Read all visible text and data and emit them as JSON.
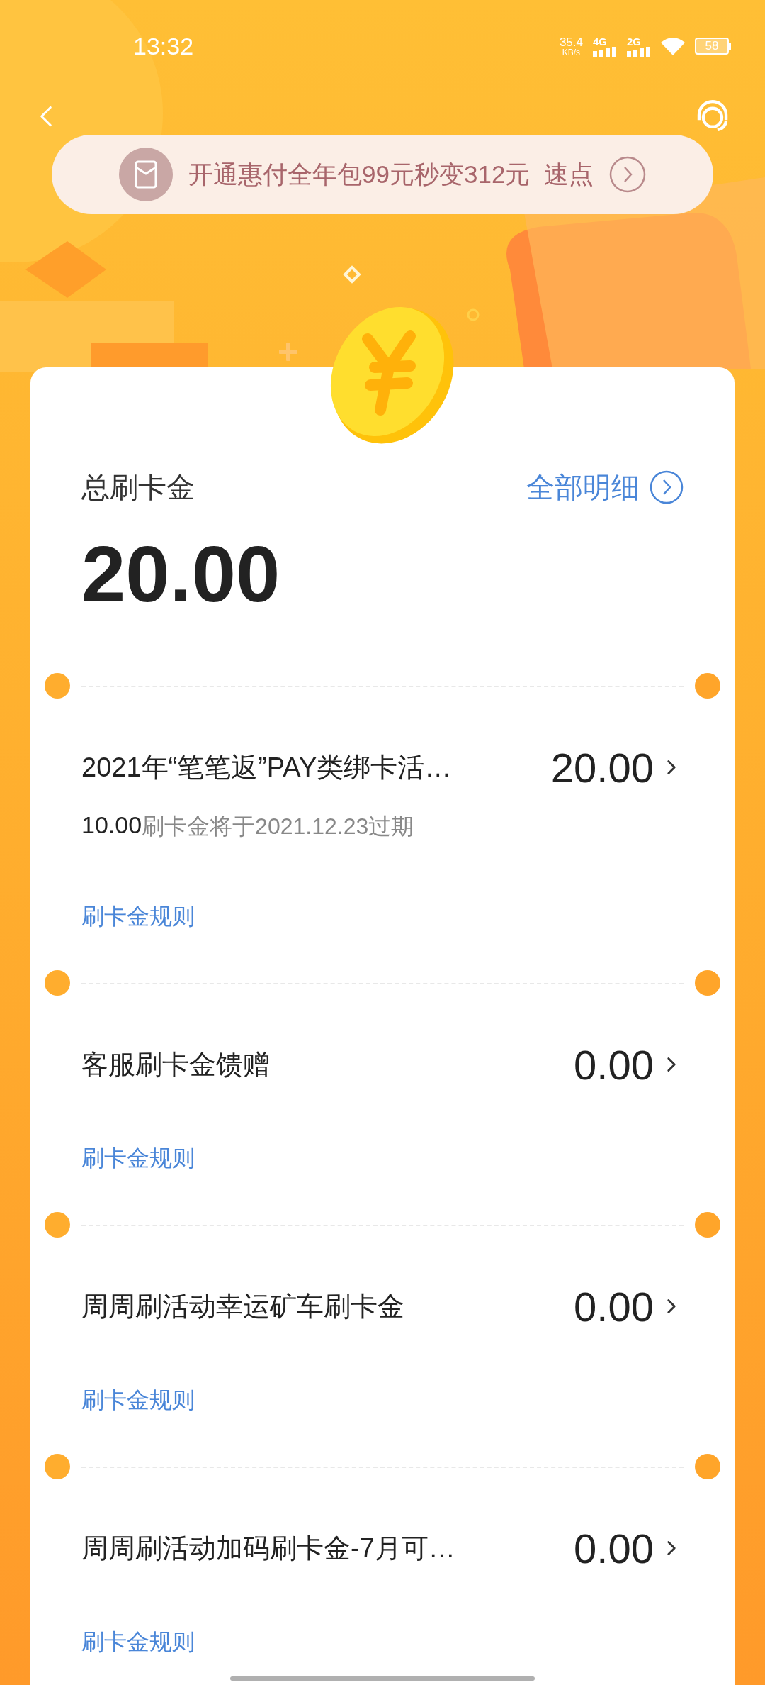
{
  "status_bar": {
    "time": "13:32",
    "net_speed": "35.4",
    "net_unit": "KB/s",
    "sim1": "4G",
    "sim2": "2G",
    "battery": "58"
  },
  "banner": {
    "text": "开通惠付全年包99元秒变312元  速点"
  },
  "summary": {
    "label": "总刷卡金",
    "detail_link": "全部明细",
    "amount": "20.00"
  },
  "items": [
    {
      "title": "2021年“笔笔返”PAY类绑卡活…",
      "amount": "20.00",
      "expiry_amount": "10.00",
      "expiry_text": "刷卡金将于2021.12.23过期",
      "rule_link": "刷卡金规则"
    },
    {
      "title": "客服刷卡金馈赠",
      "amount": "0.00",
      "rule_link": "刷卡金规则"
    },
    {
      "title": "周周刷活动幸运矿车刷卡金",
      "amount": "0.00",
      "rule_link": "刷卡金规则"
    },
    {
      "title": "周周刷活动加码刷卡金-7月可…",
      "amount": "0.00",
      "rule_link": "刷卡金规则"
    }
  ]
}
